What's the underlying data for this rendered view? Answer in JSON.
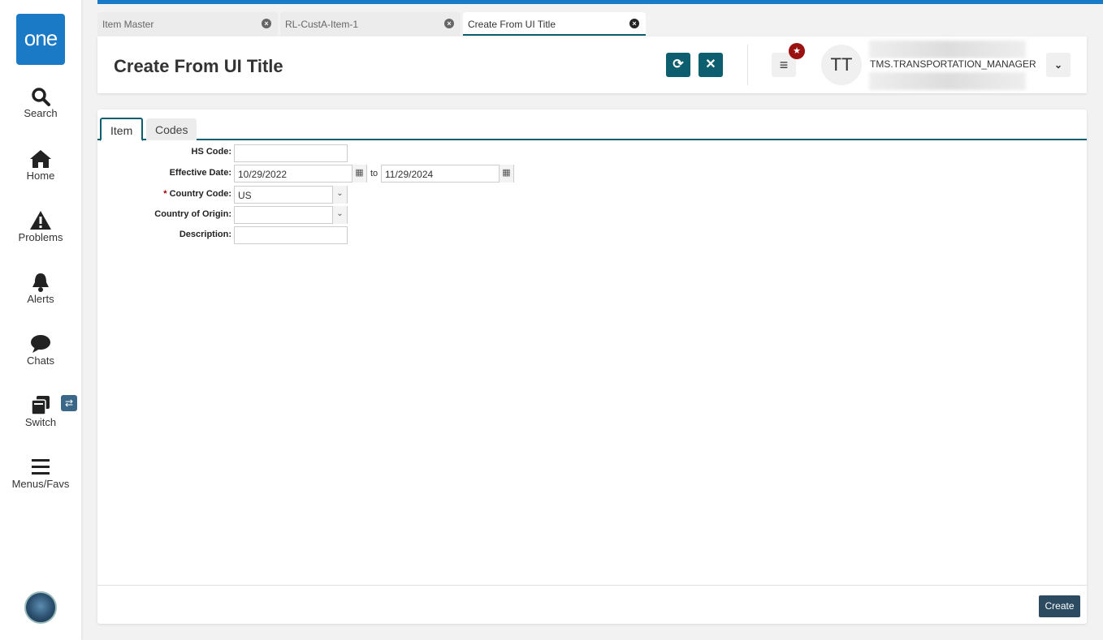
{
  "sidebar": {
    "logo": "one",
    "items": [
      {
        "label": "Search"
      },
      {
        "label": "Home"
      },
      {
        "label": "Problems"
      },
      {
        "label": "Alerts"
      },
      {
        "label": "Chats"
      },
      {
        "label": "Switch"
      },
      {
        "label": "Menus/Favs"
      }
    ]
  },
  "tabs": [
    {
      "label": "Item Master"
    },
    {
      "label": "RL-CustA-Item-1"
    },
    {
      "label": "Create From UI Title"
    }
  ],
  "header": {
    "title": "Create From UI Title",
    "avatar_initials": "TT",
    "username": "TMS.TRANSPORTATION_MANAGER"
  },
  "form": {
    "tabs": [
      {
        "label": "Item"
      },
      {
        "label": "Codes"
      }
    ],
    "hs_code": {
      "label": "HS Code:",
      "value": ""
    },
    "effective_date": {
      "label": "Effective Date:",
      "from": "10/29/2022",
      "to_label": "to",
      "to": "11/29/2024"
    },
    "country_code": {
      "required": "*",
      "label": "Country Code:",
      "value": "US"
    },
    "country_of_origin": {
      "label": "Country of Origin:",
      "value": ""
    },
    "description": {
      "label": "Description:",
      "value": ""
    }
  },
  "footer": {
    "create_label": "Create"
  },
  "colors": {
    "brand": "#1b7ac6",
    "accent": "#0d5e6e",
    "badge": "#9b1010"
  }
}
